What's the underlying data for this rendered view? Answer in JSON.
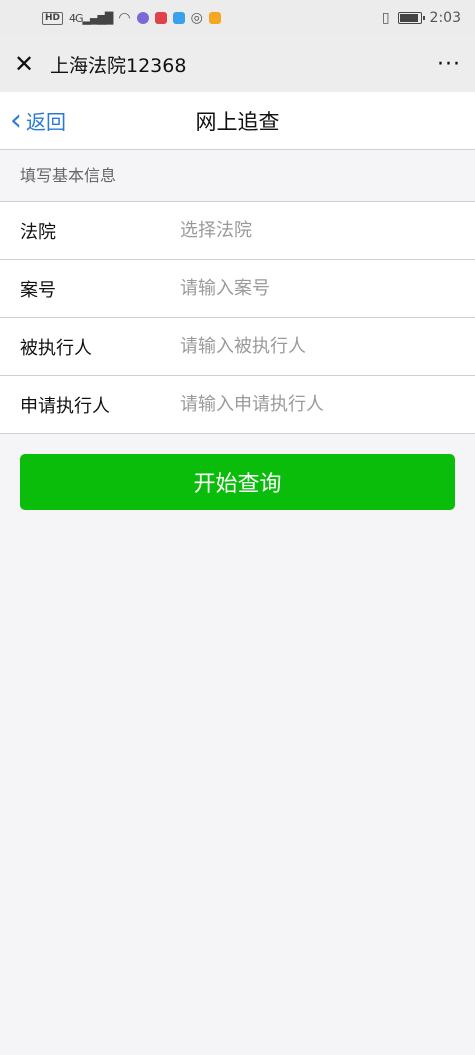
{
  "status_bar": {
    "network": "HD",
    "signal": "4G",
    "time": "2:03"
  },
  "titlebar": {
    "close_icon": "✕",
    "title": "上海法院12368",
    "more_icon": "···"
  },
  "nav": {
    "back_label": "返回",
    "title": "网上追查"
  },
  "form": {
    "section_header": "填写基本信息",
    "rows": [
      {
        "label": "法院",
        "placeholder": "选择法院"
      },
      {
        "label": "案号",
        "placeholder": "请输入案号"
      },
      {
        "label": "被执行人",
        "placeholder": "请输入被执行人"
      },
      {
        "label": "申请执行人",
        "placeholder": "请输入申请执行人"
      }
    ]
  },
  "submit_label": "开始查询",
  "colors": {
    "accent_green": "#0bbd0b",
    "link_blue": "#2a7ad2"
  }
}
